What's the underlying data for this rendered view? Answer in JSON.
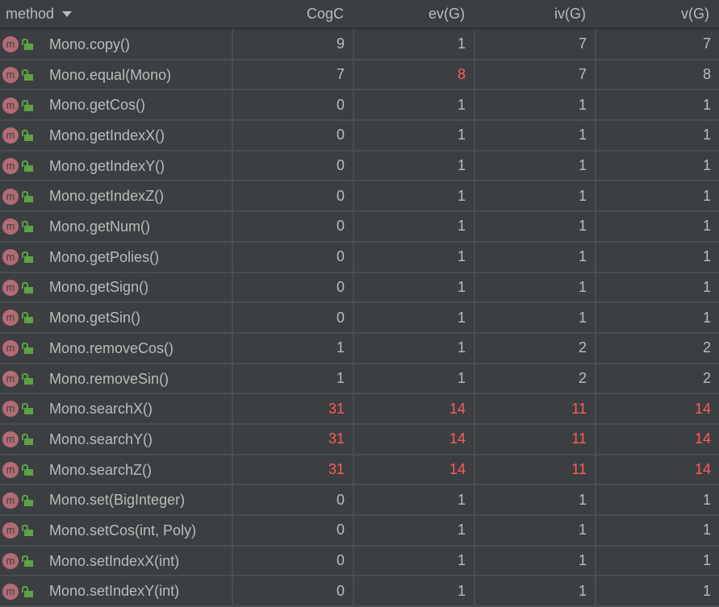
{
  "columns": [
    "method",
    "CogC",
    "ev(G)",
    "iv(G)",
    "v(G)"
  ],
  "colors": {
    "text": "#bbbbbb",
    "highlight": "#ff5a5a",
    "background": "#3c3f41"
  },
  "rows": [
    {
      "method": "Mono.copy()",
      "values": [
        "9",
        "1",
        "7",
        "7"
      ],
      "red": [
        false,
        false,
        false,
        false
      ]
    },
    {
      "method": "Mono.equal(Mono)",
      "values": [
        "7",
        "8",
        "7",
        "8"
      ],
      "red": [
        false,
        true,
        false,
        false
      ]
    },
    {
      "method": "Mono.getCos()",
      "values": [
        "0",
        "1",
        "1",
        "1"
      ],
      "red": [
        false,
        false,
        false,
        false
      ]
    },
    {
      "method": "Mono.getIndexX()",
      "values": [
        "0",
        "1",
        "1",
        "1"
      ],
      "red": [
        false,
        false,
        false,
        false
      ]
    },
    {
      "method": "Mono.getIndexY()",
      "values": [
        "0",
        "1",
        "1",
        "1"
      ],
      "red": [
        false,
        false,
        false,
        false
      ]
    },
    {
      "method": "Mono.getIndexZ()",
      "values": [
        "0",
        "1",
        "1",
        "1"
      ],
      "red": [
        false,
        false,
        false,
        false
      ]
    },
    {
      "method": "Mono.getNum()",
      "values": [
        "0",
        "1",
        "1",
        "1"
      ],
      "red": [
        false,
        false,
        false,
        false
      ]
    },
    {
      "method": "Mono.getPolies()",
      "values": [
        "0",
        "1",
        "1",
        "1"
      ],
      "red": [
        false,
        false,
        false,
        false
      ]
    },
    {
      "method": "Mono.getSign()",
      "values": [
        "0",
        "1",
        "1",
        "1"
      ],
      "red": [
        false,
        false,
        false,
        false
      ]
    },
    {
      "method": "Mono.getSin()",
      "values": [
        "0",
        "1",
        "1",
        "1"
      ],
      "red": [
        false,
        false,
        false,
        false
      ]
    },
    {
      "method": "Mono.removeCos()",
      "values": [
        "1",
        "1",
        "2",
        "2"
      ],
      "red": [
        false,
        false,
        false,
        false
      ]
    },
    {
      "method": "Mono.removeSin()",
      "values": [
        "1",
        "1",
        "2",
        "2"
      ],
      "red": [
        false,
        false,
        false,
        false
      ]
    },
    {
      "method": "Mono.searchX()",
      "values": [
        "31",
        "14",
        "11",
        "14"
      ],
      "red": [
        true,
        true,
        true,
        true
      ]
    },
    {
      "method": "Mono.searchY()",
      "values": [
        "31",
        "14",
        "11",
        "14"
      ],
      "red": [
        true,
        true,
        true,
        true
      ]
    },
    {
      "method": "Mono.searchZ()",
      "values": [
        "31",
        "14",
        "11",
        "14"
      ],
      "red": [
        true,
        true,
        true,
        true
      ]
    },
    {
      "method": "Mono.set(BigInteger)",
      "values": [
        "0",
        "1",
        "1",
        "1"
      ],
      "red": [
        false,
        false,
        false,
        false
      ]
    },
    {
      "method": "Mono.setCos(int, Poly)",
      "values": [
        "0",
        "1",
        "1",
        "1"
      ],
      "red": [
        false,
        false,
        false,
        false
      ]
    },
    {
      "method": "Mono.setIndexX(int)",
      "values": [
        "0",
        "1",
        "1",
        "1"
      ],
      "red": [
        false,
        false,
        false,
        false
      ]
    },
    {
      "method": "Mono.setIndexY(int)",
      "values": [
        "0",
        "1",
        "1",
        "1"
      ],
      "red": [
        false,
        false,
        false,
        false
      ]
    }
  ]
}
